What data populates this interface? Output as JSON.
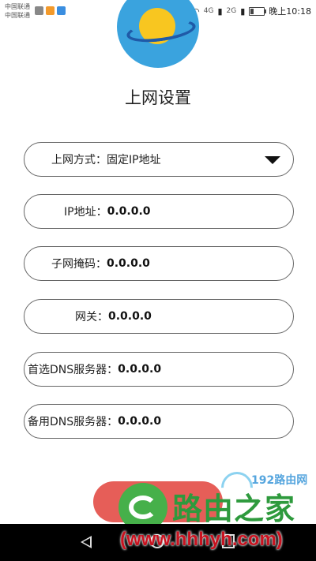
{
  "statusbar": {
    "carrier1": "中国联通",
    "carrier2": "中国联通",
    "signal1": "4G",
    "signal2": "2G",
    "time": "晚上10:18"
  },
  "header": {
    "title": "上网设置"
  },
  "form": {
    "mode": {
      "label": "上网方式：",
      "value": "固定IP地址"
    },
    "ip": {
      "label": "IP地址：",
      "value": "0.0.0.0"
    },
    "mask": {
      "label": "子网掩码：",
      "value": "0.0.0.0"
    },
    "gateway": {
      "label": "网关：",
      "value": "0.0.0.0"
    },
    "dns1": {
      "label": "首选DNS服务器：",
      "value": "0.0.0.0"
    },
    "dns2": {
      "label": "备用DNS服务器：",
      "value": "0.0.0.0"
    }
  },
  "watermark": {
    "brand": "路由之家",
    "url": "(www.hhhyh.com)",
    "top_text": "192路由网"
  },
  "colors": {
    "logo_bg": "#3aa3de",
    "planet": "#f8c620",
    "button": "#e65e58",
    "watermark_green": "#2e9a3d",
    "watermark_red": "#c8121f"
  }
}
